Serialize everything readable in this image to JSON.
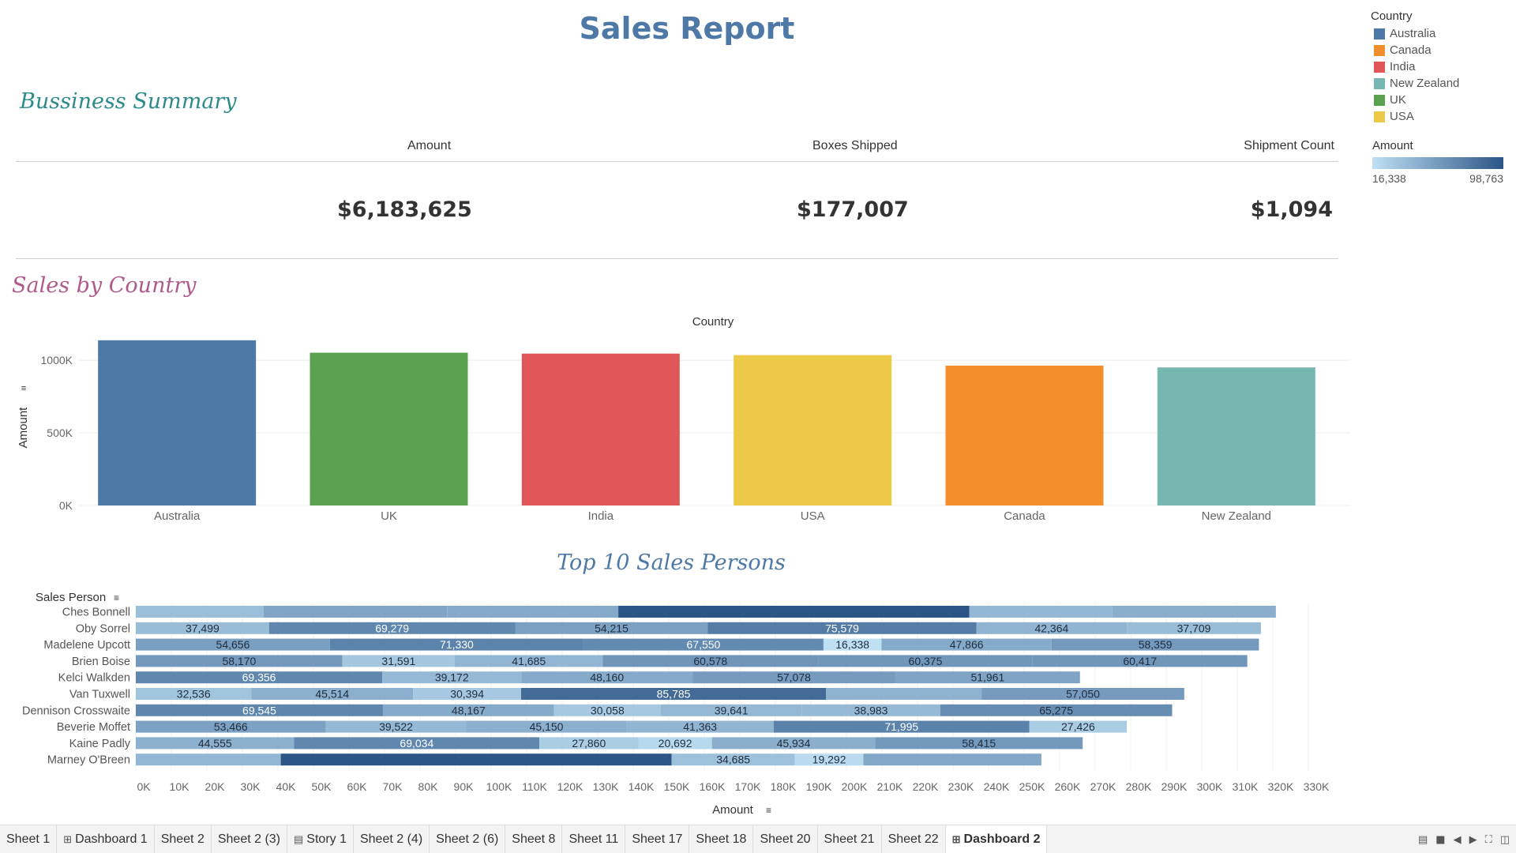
{
  "report_title": "Sales Report",
  "sections": {
    "business_summary": "Bussiness  Summary",
    "sales_by_country": "Sales by Country",
    "top10": "Top 10 Sales Persons"
  },
  "kpis": [
    {
      "label": "Amount",
      "value": "$6,183,625"
    },
    {
      "label": "Boxes Shipped",
      "value": "$177,007"
    },
    {
      "label": "Shipment Count",
      "value": "$1,094"
    }
  ],
  "legend": {
    "title": "Country",
    "items": [
      {
        "label": "Australia",
        "color": "#4e79a7"
      },
      {
        "label": "Canada",
        "color": "#f28e2b"
      },
      {
        "label": "India",
        "color": "#e15759"
      },
      {
        "label": "New Zealand",
        "color": "#76b7b2"
      },
      {
        "label": "UK",
        "color": "#59a14f"
      },
      {
        "label": "USA",
        "color": "#edc948"
      }
    ]
  },
  "amount_legend": {
    "title": "Amount",
    "min": "16,338",
    "max": "98,763",
    "min_value": 16338,
    "max_value": 98763
  },
  "chart_data": [
    {
      "type": "bar",
      "header": "Country",
      "categories": [
        "Australia",
        "UK",
        "India",
        "USA",
        "Canada",
        "New Zealand"
      ],
      "values": [
        1137367,
        1051792,
        1045800,
        1035349,
        962899,
        950418
      ],
      "colors": [
        "#4e79a7",
        "#59a14f",
        "#e15759",
        "#edc948",
        "#f28e2b",
        "#76b7b2"
      ],
      "ylabel": "Amount",
      "ylim": [
        0,
        1180000
      ],
      "yticks": [
        0,
        500000,
        1000000
      ],
      "ytick_labels": [
        "0K",
        "500K",
        "1000K"
      ],
      "grid": true
    },
    {
      "type": "bar",
      "orientation": "horizontal",
      "stacked": true,
      "row_header": "Sales Person",
      "xlabel": "Amount",
      "xlim": [
        0,
        330000
      ],
      "xticks": [
        "0K",
        "10K",
        "20K",
        "30K",
        "40K",
        "50K",
        "60K",
        "70K",
        "80K",
        "90K",
        "100K",
        "110K",
        "120K",
        "130K",
        "140K",
        "150K",
        "160K",
        "170K",
        "180K",
        "190K",
        "200K",
        "210K",
        "220K",
        "230K",
        "240K",
        "250K",
        "260K",
        "270K",
        "280K",
        "290K",
        "300K",
        "310K",
        "320K",
        "330K"
      ],
      "rows": [
        {
          "name": "Ches Bonnell",
          "segments": [
            {
              "value": 36000,
              "label": ""
            },
            {
              "value": 51600,
              "label": ""
            },
            {
              "value": 48200,
              "label": ""
            },
            {
              "value": 98763,
              "label": ""
            },
            {
              "value": 40300,
              "label": ""
            },
            {
              "value": 46000,
              "label": ""
            }
          ]
        },
        {
          "name": "Oby Sorrel",
          "segments": [
            {
              "value": 37499,
              "label": "37,499"
            },
            {
              "value": 69279,
              "label": "69,279"
            },
            {
              "value": 54215,
              "label": "54,215"
            },
            {
              "value": 75579,
              "label": "75,579"
            },
            {
              "value": 42364,
              "label": "42,364"
            },
            {
              "value": 37709,
              "label": "37,709"
            }
          ]
        },
        {
          "name": "Madelene Upcott",
          "segments": [
            {
              "value": 54656,
              "label": "54,656"
            },
            {
              "value": 71330,
              "label": "71,330"
            },
            {
              "value": 67550,
              "label": "67,550"
            },
            {
              "value": 16338,
              "label": "16,338"
            },
            {
              "value": 47866,
              "label": "47,866"
            },
            {
              "value": 58359,
              "label": "58,359"
            }
          ]
        },
        {
          "name": "Brien Boise",
          "segments": [
            {
              "value": 58170,
              "label": "58,170"
            },
            {
              "value": 31591,
              "label": "31,591"
            },
            {
              "value": 41685,
              "label": "41,685"
            },
            {
              "value": 60578,
              "label": "60,578"
            },
            {
              "value": 60375,
              "label": "60,375"
            },
            {
              "value": 60417,
              "label": "60,417"
            }
          ]
        },
        {
          "name": "Kelci Walkden",
          "segments": [
            {
              "value": 69356,
              "label": "69,356"
            },
            {
              "value": 39172,
              "label": "39,172"
            },
            {
              "value": 48160,
              "label": "48,160"
            },
            {
              "value": 57078,
              "label": "57,078"
            },
            {
              "value": 51961,
              "label": "51,961"
            }
          ]
        },
        {
          "name": "Van Tuxwell",
          "segments": [
            {
              "value": 32536,
              "label": "32,536"
            },
            {
              "value": 45514,
              "label": "45,514"
            },
            {
              "value": 30394,
              "label": "30,394"
            },
            {
              "value": 85785,
              "label": "85,785"
            },
            {
              "value": 43800,
              "label": ""
            },
            {
              "value": 57050,
              "label": "57,050"
            }
          ]
        },
        {
          "name": "Dennison Crosswaite",
          "segments": [
            {
              "value": 69545,
              "label": "69,545"
            },
            {
              "value": 48167,
              "label": "48,167"
            },
            {
              "value": 30058,
              "label": "30,058"
            },
            {
              "value": 39641,
              "label": "39,641"
            },
            {
              "value": 38983,
              "label": "38,983"
            },
            {
              "value": 65275,
              "label": "65,275"
            }
          ]
        },
        {
          "name": "Beverie Moffet",
          "segments": [
            {
              "value": 53466,
              "label": "53,466"
            },
            {
              "value": 39522,
              "label": "39,522"
            },
            {
              "value": 45150,
              "label": "45,150"
            },
            {
              "value": 41363,
              "label": "41,363"
            },
            {
              "value": 71995,
              "label": "71,995"
            },
            {
              "value": 27426,
              "label": "27,426"
            }
          ]
        },
        {
          "name": "Kaine Padly",
          "segments": [
            {
              "value": 44555,
              "label": "44,555"
            },
            {
              "value": 69034,
              "label": "69,034"
            },
            {
              "value": 27860,
              "label": "27,860"
            },
            {
              "value": 20692,
              "label": "20,692"
            },
            {
              "value": 45934,
              "label": "45,934"
            },
            {
              "value": 58415,
              "label": "58,415"
            }
          ]
        },
        {
          "name": "Marney O'Breen",
          "segments": [
            {
              "value": 40800,
              "label": ""
            },
            {
              "value": 110000,
              "label": ""
            },
            {
              "value": 34685,
              "label": "34,685"
            },
            {
              "value": 19292,
              "label": "19,292"
            },
            {
              "value": 50100,
              "label": ""
            }
          ]
        }
      ]
    }
  ],
  "tabs": [
    {
      "label": "Sheet 1",
      "icon": "",
      "active": false
    },
    {
      "label": "Dashboard 1",
      "icon": "dashboard-icon",
      "active": false
    },
    {
      "label": "Sheet 2",
      "icon": "",
      "active": false
    },
    {
      "label": "Sheet 2 (3)",
      "icon": "",
      "active": false
    },
    {
      "label": "Story 1",
      "icon": "story-icon",
      "active": false
    },
    {
      "label": "Sheet 2 (4)",
      "icon": "",
      "active": false
    },
    {
      "label": "Sheet 2 (6)",
      "icon": "",
      "active": false
    },
    {
      "label": "Sheet 8",
      "icon": "",
      "active": false
    },
    {
      "label": "Sheet 11",
      "icon": "",
      "active": false
    },
    {
      "label": "Sheet 17",
      "icon": "",
      "active": false
    },
    {
      "label": "Sheet 18",
      "icon": "",
      "active": false
    },
    {
      "label": "Sheet 20",
      "icon": "",
      "active": false
    },
    {
      "label": "Sheet 21",
      "icon": "",
      "active": false
    },
    {
      "label": "Sheet 22",
      "icon": "",
      "active": false
    },
    {
      "label": "Dashboard 2",
      "icon": "dashboard-icon",
      "active": true
    }
  ]
}
